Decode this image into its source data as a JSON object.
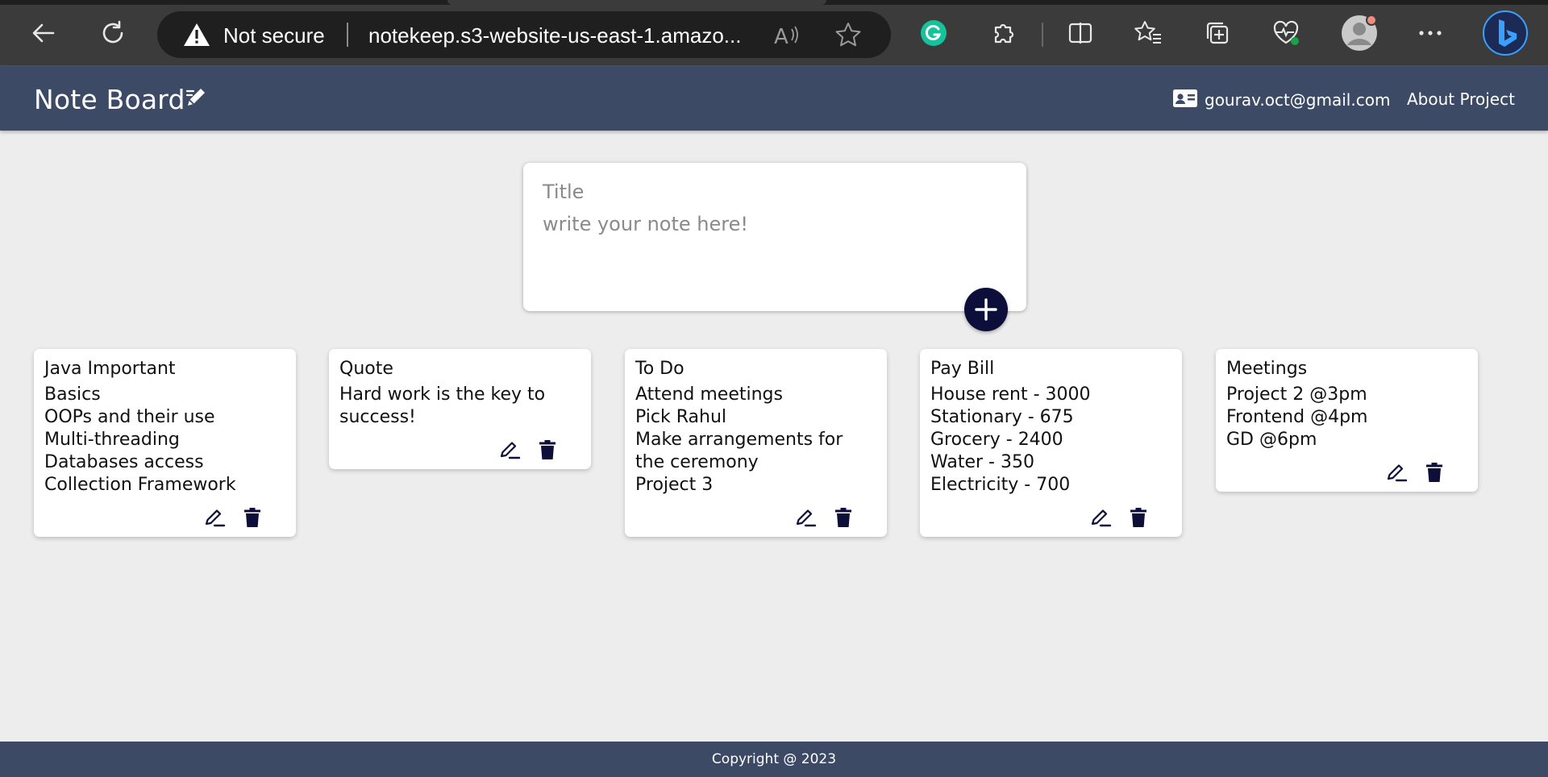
{
  "browser": {
    "security_label": "Not secure",
    "url": "notekeep.s3-website-us-east-1.amazo...",
    "icons": [
      "back-icon",
      "refresh-icon",
      "warning-icon",
      "read-aloud-icon",
      "favorite-star-icon",
      "grammarly-icon",
      "extensions-icon",
      "split-screen-icon",
      "favorites-icon",
      "collections-icon",
      "browser-essentials-icon",
      "profile-avatar",
      "more-menu-icon",
      "bing-copilot-icon"
    ]
  },
  "header": {
    "title": "Note Board",
    "email": "gourav.oct@gmail.com",
    "about_label": "About Project"
  },
  "composer": {
    "title_placeholder": "Title",
    "body_placeholder": "write your note here!"
  },
  "notes": [
    {
      "title": "Java Important",
      "lines": [
        "Basics",
        "OOPs and their use",
        "Multi-threading",
        "Databases access",
        "Collection Framework"
      ]
    },
    {
      "title": "Quote",
      "lines": [
        "Hard work is the key to",
        "success!"
      ]
    },
    {
      "title": "To Do",
      "lines": [
        "Attend meetings",
        "Pick Rahul",
        "Make arrangements for",
        "the ceremony",
        "Project 3"
      ]
    },
    {
      "title": "Pay Bill",
      "lines": [
        "House rent - 3000",
        "Stationary - 675",
        "Grocery - 2400",
        "Water - 350",
        "Electricity - 700"
      ]
    },
    {
      "title": "Meetings",
      "lines": [
        "Project 2 @3pm",
        "Frontend @4pm",
        "GD @6pm"
      ]
    }
  ],
  "footer": {
    "text": "Copyright @ 2023"
  },
  "colors": {
    "header_bg": "#3c4a66",
    "accent": "#0e0e3a",
    "page_bg": "#ededed"
  }
}
